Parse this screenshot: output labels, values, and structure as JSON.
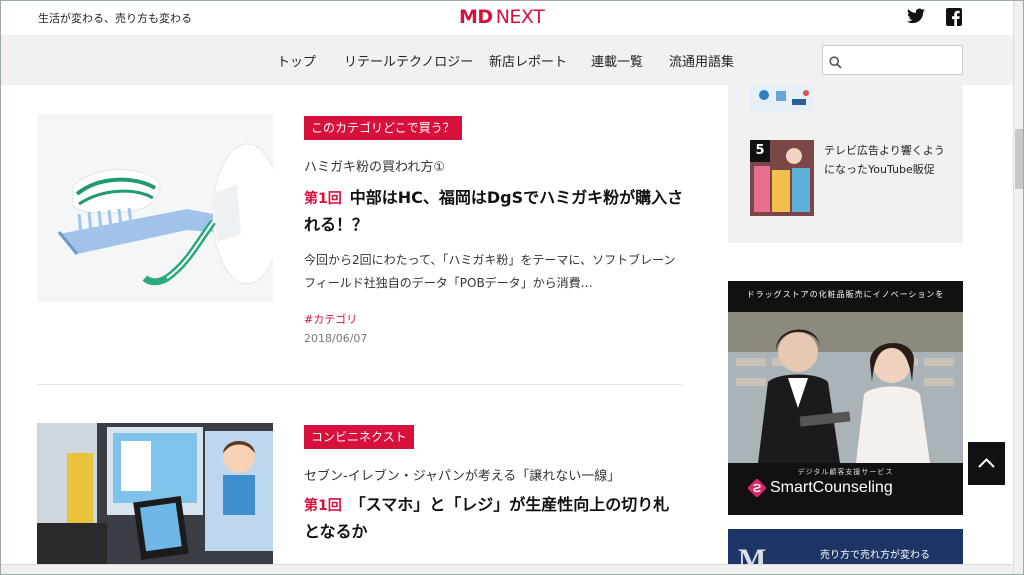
{
  "header": {
    "tagline": "生活が変わる、売り方も変わる",
    "logo_bold": "MD",
    "logo_rest": "NEXT",
    "social": [
      "twitter-icon",
      "facebook-icon"
    ]
  },
  "nav": {
    "items": [
      "トップ",
      "リテールテクノロジー",
      "新店レポート",
      "連載一覧",
      "流通用語集"
    ],
    "search_placeholder": ""
  },
  "articles": [
    {
      "category": "このカテゴリどこで買う？",
      "series": "ハミガキ粉の買われ方①",
      "number": "第1回",
      "title": "中部はHC、福岡はDgSでハミガキ粉が購入される！？",
      "excerpt": "今回から2回にわたって、「ハミガキ粉」をテーマに、ソフトブレーンフィールド社独自のデータ「POBデータ」から消費…",
      "hashtag": "#カテゴリ",
      "date": "2018/06/07"
    },
    {
      "category": "コンビニネクスト",
      "series": "セブン-イレブン・ジャパンが考える「譲れない一線」",
      "number": "第1回",
      "title": "「スマホ」と「レジ」が生産性向上の切り札となるか"
    }
  ],
  "sidebar": {
    "ranking": [
      {
        "rank": "5",
        "title": "テレビ広告より響くようになったYouTube販促"
      }
    ],
    "ad1": {
      "headline": "ドラッグストアの化粧品販売にイノベーションを",
      "subline": "デジタル顧客支援サービス",
      "brand": "SmartCounseling"
    },
    "ad2": {
      "letter": "M",
      "text": "売り方で売れ方が変わる"
    }
  },
  "colors": {
    "accent": "#d8103c",
    "nav_bg": "#f1f1f1",
    "dark": "#111111"
  }
}
